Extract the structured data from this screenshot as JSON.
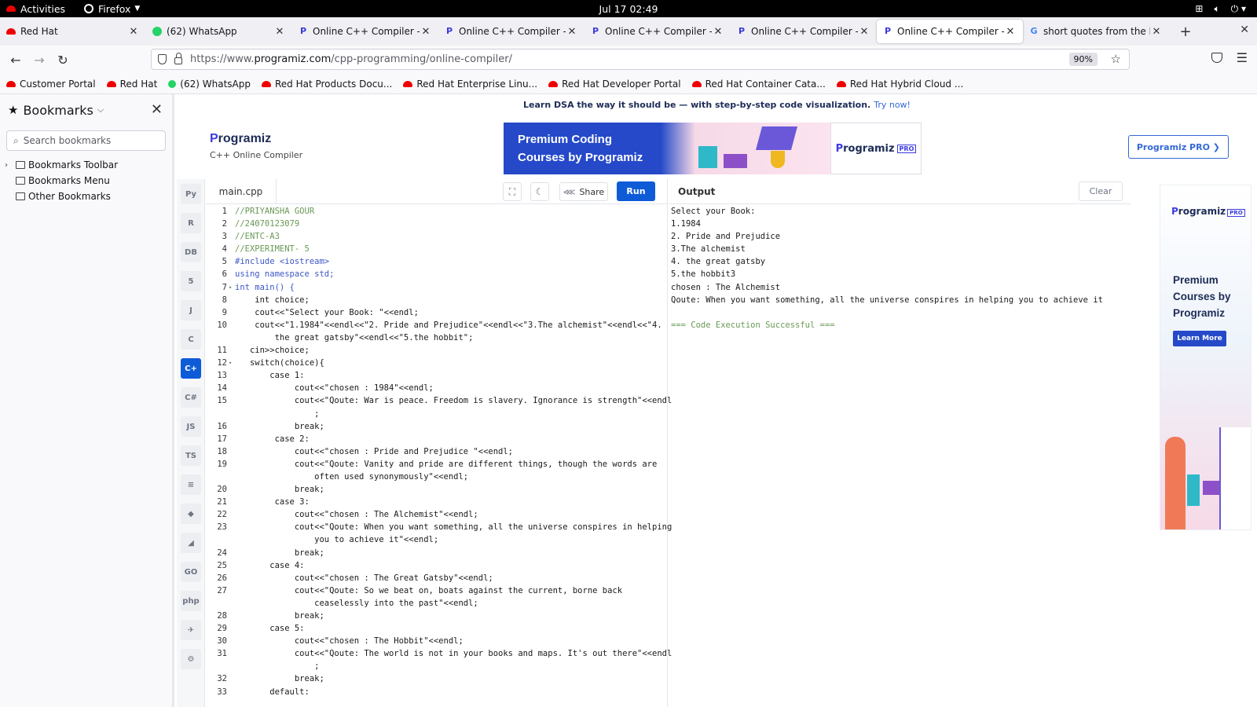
{
  "system_bar": {
    "activities": "Activities",
    "app_name": "Firefox",
    "clock": "Jul 17  02:49"
  },
  "tabs": [
    {
      "label": "Red Hat",
      "favicon": "redhat-icon",
      "active": false
    },
    {
      "label": "(62) WhatsApp",
      "favicon": "whatsapp-icon",
      "active": false
    },
    {
      "label": "Online C++ Compiler - Pr",
      "favicon": "programiz-icon",
      "active": false
    },
    {
      "label": "Online C++ Compiler - Pr",
      "favicon": "programiz-icon",
      "active": false
    },
    {
      "label": "Online C++ Compiler - Pr",
      "favicon": "programiz-icon",
      "active": false
    },
    {
      "label": "Online C++ Compiler - Pr",
      "favicon": "programiz-icon",
      "active": false
    },
    {
      "label": "Online C++ Compiler - Pr",
      "favicon": "programiz-icon",
      "active": true
    },
    {
      "label": "short quotes from the hob",
      "favicon": "google-icon",
      "active": false
    }
  ],
  "navbar": {
    "url_prefix": "https://www.",
    "url_domain": "programiz.com",
    "url_path": "/cpp-programming/online-compiler/",
    "zoom": "90%"
  },
  "bookmarks_bar": [
    {
      "label": "Customer Portal",
      "icon": "redhat"
    },
    {
      "label": "Red Hat",
      "icon": "redhat"
    },
    {
      "label": "(62) WhatsApp",
      "icon": "whatsapp"
    },
    {
      "label": "Red Hat Products Docu...",
      "icon": "redhat"
    },
    {
      "label": "Red Hat Enterprise Linu...",
      "icon": "redhat"
    },
    {
      "label": "Red Hat Developer Portal",
      "icon": "redhat"
    },
    {
      "label": "Red Hat Container Cata...",
      "icon": "redhat"
    },
    {
      "label": "Red Hat Hybrid Cloud ...",
      "icon": "redhat"
    }
  ],
  "sidebar": {
    "title": "Bookmarks",
    "search_placeholder": "Search bookmarks",
    "items": [
      {
        "label": "Bookmarks Toolbar",
        "expandable": true
      },
      {
        "label": "Bookmarks Menu",
        "expandable": false
      },
      {
        "label": "Other Bookmarks",
        "expandable": false
      }
    ]
  },
  "page": {
    "promo_text": "Learn DSA the way it should be — with step-by-step code visualization.",
    "promo_link": "Try now!",
    "logo_text": "rogramiz",
    "logo_sub": "C++ Online Compiler",
    "banner_title_1": "Premium Coding",
    "banner_title_2": "Courses by Programiz",
    "banner_brand": "rogramiz",
    "banner_pro": "PRO",
    "pro_button": "Programiz PRO ❯",
    "accent": "#0e5bd8"
  },
  "languages": [
    {
      "icon": "python-icon",
      "glyph": "Py",
      "active": false
    },
    {
      "icon": "r-icon",
      "glyph": "R",
      "active": false
    },
    {
      "icon": "sql-icon",
      "glyph": "DB",
      "active": false
    },
    {
      "icon": "html-icon",
      "glyph": "5",
      "active": false
    },
    {
      "icon": "java-icon",
      "glyph": "J",
      "active": false
    },
    {
      "icon": "c-icon",
      "glyph": "C",
      "active": false
    },
    {
      "icon": "cpp-icon",
      "glyph": "C+",
      "active": true
    },
    {
      "icon": "csharp-icon",
      "glyph": "C#",
      "active": false
    },
    {
      "icon": "javascript-icon",
      "glyph": "JS",
      "active": false
    },
    {
      "icon": "typescript-icon",
      "glyph": "TS",
      "active": false
    },
    {
      "icon": "scala-icon",
      "glyph": "≡",
      "active": false
    },
    {
      "icon": "ruby-icon",
      "glyph": "◆",
      "active": false
    },
    {
      "icon": "rust-icon",
      "glyph": "◢",
      "active": false
    },
    {
      "icon": "go-icon",
      "glyph": "GO",
      "active": false
    },
    {
      "icon": "php-icon",
      "glyph": "php",
      "active": false
    },
    {
      "icon": "swift-icon",
      "glyph": "✈",
      "active": false
    },
    {
      "icon": "rust-gear-icon",
      "glyph": "⚙",
      "active": false
    }
  ],
  "editor": {
    "filename": "main.cpp",
    "share_label": "Share",
    "run_label": "Run",
    "lines": [
      {
        "n": "1",
        "text": "//PRIYANSHA GOUR",
        "kind": "cmt",
        "fold": ""
      },
      {
        "n": "2",
        "text": "//24070123079",
        "kind": "cmt",
        "fold": ""
      },
      {
        "n": "3",
        "text": "//ENTC-A3",
        "kind": "cmt",
        "fold": ""
      },
      {
        "n": "4",
        "text": "//EXPERIMENT- 5",
        "kind": "cmt",
        "fold": ""
      },
      {
        "n": "5",
        "text": "#include <iostream>",
        "kind": "inc",
        "fold": ""
      },
      {
        "n": "6",
        "text": "using namespace std;",
        "kind": "kw",
        "fold": ""
      },
      {
        "n": "7",
        "text": "int main() {",
        "kind": "kw",
        "fold": "▾"
      },
      {
        "n": "8",
        "text": "    int choice;",
        "kind": "",
        "fold": ""
      },
      {
        "n": "9",
        "text": "    cout<<\"Select your Book: \"<<endl;",
        "kind": "",
        "fold": ""
      },
      {
        "n": "10",
        "text": "    cout<<\"1.1984\"<<endl<<\"2. Pride and Prejudice\"<<endl<<\"3.The alchemist\"<<endl<<\"4.\n        the great gatsby\"<<endl<<\"5.the hobbit\";",
        "kind": "",
        "fold": ""
      },
      {
        "n": "11",
        "text": "   cin>>choice;",
        "kind": "",
        "fold": ""
      },
      {
        "n": "12",
        "text": "   switch(choice){",
        "kind": "",
        "fold": "▾"
      },
      {
        "n": "13",
        "text": "       case 1:",
        "kind": "",
        "fold": ""
      },
      {
        "n": "14",
        "text": "            cout<<\"chosen : 1984\"<<endl;",
        "kind": "",
        "fold": ""
      },
      {
        "n": "15",
        "text": "            cout<<\"Qoute: War is peace. Freedom is slavery. Ignorance is strength\"<<endl\n                ;",
        "kind": "",
        "fold": ""
      },
      {
        "n": "16",
        "text": "            break;",
        "kind": "",
        "fold": ""
      },
      {
        "n": "17",
        "text": "        case 2:",
        "kind": "",
        "fold": ""
      },
      {
        "n": "18",
        "text": "            cout<<\"chosen : Pride and Prejudice \"<<endl;",
        "kind": "",
        "fold": ""
      },
      {
        "n": "19",
        "text": "            cout<<\"Qoute: Vanity and pride are different things, though the words are\n                often used synonymously\"<<endl;",
        "kind": "",
        "fold": ""
      },
      {
        "n": "20",
        "text": "            break;",
        "kind": "",
        "fold": ""
      },
      {
        "n": "21",
        "text": "        case 3:",
        "kind": "",
        "fold": ""
      },
      {
        "n": "22",
        "text": "            cout<<\"chosen : The Alchemist\"<<endl;",
        "kind": "",
        "fold": ""
      },
      {
        "n": "23",
        "text": "            cout<<\"Qoute: When you want something, all the universe conspires in helping\n                you to achieve it\"<<endl;",
        "kind": "",
        "fold": ""
      },
      {
        "n": "24",
        "text": "            break;",
        "kind": "",
        "fold": ""
      },
      {
        "n": "25",
        "text": "       case 4:",
        "kind": "",
        "fold": ""
      },
      {
        "n": "26",
        "text": "            cout<<\"chosen : The Great Gatsby\"<<endl;",
        "kind": "",
        "fold": ""
      },
      {
        "n": "27",
        "text": "            cout<<\"Qoute: So we beat on, boats against the current, borne back\n                ceaselessly into the past\"<<endl;",
        "kind": "",
        "fold": ""
      },
      {
        "n": "28",
        "text": "            break;",
        "kind": "",
        "fold": ""
      },
      {
        "n": "29",
        "text": "       case 5:",
        "kind": "",
        "fold": ""
      },
      {
        "n": "30",
        "text": "            cout<<\"chosen : The Hobbit\"<<endl;",
        "kind": "",
        "fold": ""
      },
      {
        "n": "31",
        "text": "            cout<<\"Qoute: The world is not in your books and maps. It's out there\"<<endl\n                ;",
        "kind": "",
        "fold": ""
      },
      {
        "n": "32",
        "text": "            break;",
        "kind": "",
        "fold": ""
      },
      {
        "n": "33",
        "text": "       default:",
        "kind": "",
        "fold": ""
      }
    ]
  },
  "output": {
    "title": "Output",
    "clear_label": "Clear",
    "lines": [
      "Select your Book:",
      "1.1984",
      "2. Pride and Prejudice",
      "3.The alchemist",
      "4. the great gatsby",
      "5.the hobbit3",
      "chosen : The Alchemist",
      "Qoute: When you want something, all the universe conspires in helping you to achieve it"
    ],
    "status": "=== Code Execution Successful ==="
  },
  "ad": {
    "brand": "rogramiz",
    "pro": "PRO",
    "title_1": "Premium",
    "title_2": "Courses by",
    "title_3": "Programiz",
    "button": "Learn More"
  }
}
